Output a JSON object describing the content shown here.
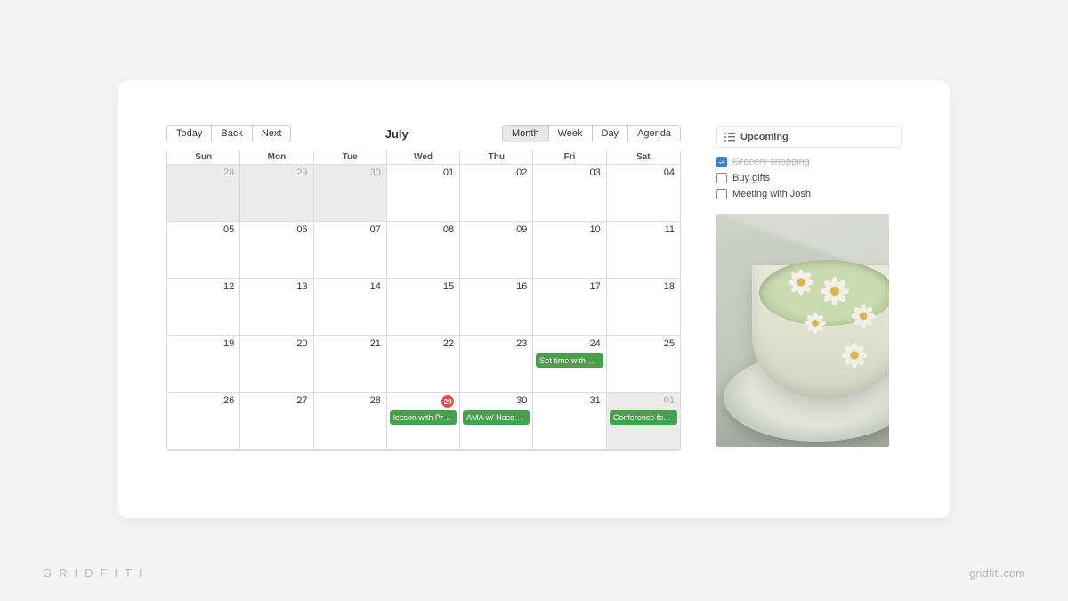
{
  "toolbar": {
    "today": "Today",
    "back": "Back",
    "next": "Next",
    "title": "July",
    "views": {
      "month": "Month",
      "week": "Week",
      "day": "Day",
      "agenda": "Agenda"
    },
    "active_view": "Month"
  },
  "weekdays": [
    "Sun",
    "Mon",
    "Tue",
    "Wed",
    "Thu",
    "Fri",
    "Sat"
  ],
  "cells": [
    {
      "num": "28",
      "out": true
    },
    {
      "num": "29",
      "out": true
    },
    {
      "num": "30",
      "out": true
    },
    {
      "num": "01"
    },
    {
      "num": "02"
    },
    {
      "num": "03"
    },
    {
      "num": "04"
    },
    {
      "num": "05"
    },
    {
      "num": "06"
    },
    {
      "num": "07"
    },
    {
      "num": "08"
    },
    {
      "num": "09"
    },
    {
      "num": "10"
    },
    {
      "num": "11"
    },
    {
      "num": "12"
    },
    {
      "num": "13"
    },
    {
      "num": "14"
    },
    {
      "num": "15"
    },
    {
      "num": "16"
    },
    {
      "num": "17"
    },
    {
      "num": "18"
    },
    {
      "num": "19"
    },
    {
      "num": "20"
    },
    {
      "num": "21"
    },
    {
      "num": "22"
    },
    {
      "num": "23"
    },
    {
      "num": "24",
      "event": "Set time with Li…"
    },
    {
      "num": "25"
    },
    {
      "num": "26"
    },
    {
      "num": "27"
    },
    {
      "num": "28"
    },
    {
      "num": "29",
      "today": true,
      "event": "lesson with Prof…"
    },
    {
      "num": "30",
      "event": "AMA w/ Hasque…"
    },
    {
      "num": "31"
    },
    {
      "num": "01",
      "out": true,
      "event": "Conference for …"
    }
  ],
  "upcoming": {
    "title": "Upcoming",
    "items": [
      {
        "label": "Grocery shopping",
        "done": true
      },
      {
        "label": "Buy gifts",
        "done": false
      },
      {
        "label": "Meeting with Josh",
        "done": false
      }
    ]
  },
  "watermark": {
    "left": "GRIDFITI",
    "right": "gridfiti.com"
  },
  "colors": {
    "event": "#4b9e4b",
    "today_badge": "#d9534f",
    "check": "#3b82d4"
  }
}
